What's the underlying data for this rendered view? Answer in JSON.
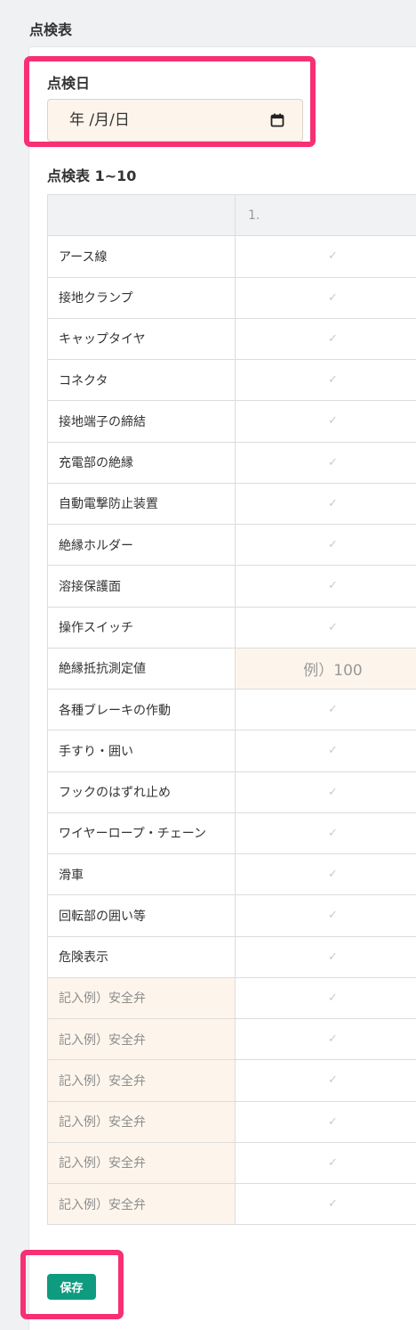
{
  "page_title": "点検表",
  "date_section": {
    "label": "点検日",
    "input_display": "年 /月/日"
  },
  "table_section": {
    "title": "点検表 1~10",
    "header": {
      "label_col": "",
      "value_col": "1."
    },
    "check_mark": "✓",
    "rows": [
      {
        "label": "アース線",
        "value": "✓"
      },
      {
        "label": "接地クランプ",
        "value": "✓"
      },
      {
        "label": "キャップタイヤ",
        "value": "✓"
      },
      {
        "label": "コネクタ",
        "value": "✓"
      },
      {
        "label": "接地端子の締結",
        "value": "✓"
      },
      {
        "label": "充電部の絶縁",
        "value": "✓"
      },
      {
        "label": "自動電撃防止装置",
        "value": "✓"
      },
      {
        "label": "絶縁ホルダー",
        "value": "✓"
      },
      {
        "label": "溶接保護面",
        "value": "✓"
      },
      {
        "label": "操作スイッチ",
        "value": "✓"
      },
      {
        "label": "絶縁抵抗測定値",
        "value": "例）100"
      },
      {
        "label": "各種ブレーキの作動",
        "value": "✓"
      },
      {
        "label": "手すり・囲い",
        "value": "✓"
      },
      {
        "label": "フックのはずれ止め",
        "value": "✓"
      },
      {
        "label": "ワイヤーロープ・チェーン",
        "value": "✓"
      },
      {
        "label": "滑車",
        "value": "✓"
      },
      {
        "label": "回転部の囲い等",
        "value": "✓"
      },
      {
        "label": "危険表示",
        "value": "✓"
      },
      {
        "label": "記入例）安全弁",
        "value": "✓"
      },
      {
        "label": "記入例）安全弁",
        "value": "✓"
      },
      {
        "label": "記入例）安全弁",
        "value": "✓"
      },
      {
        "label": "記入例）安全弁",
        "value": "✓"
      },
      {
        "label": "記入例）安全弁",
        "value": "✓"
      },
      {
        "label": "記入例）安全弁",
        "value": "✓"
      }
    ]
  },
  "save_button": "保存",
  "colors": {
    "highlight": "#f72f74",
    "save_button": "#0e9b80",
    "input_bg": "#fdf5ec"
  }
}
